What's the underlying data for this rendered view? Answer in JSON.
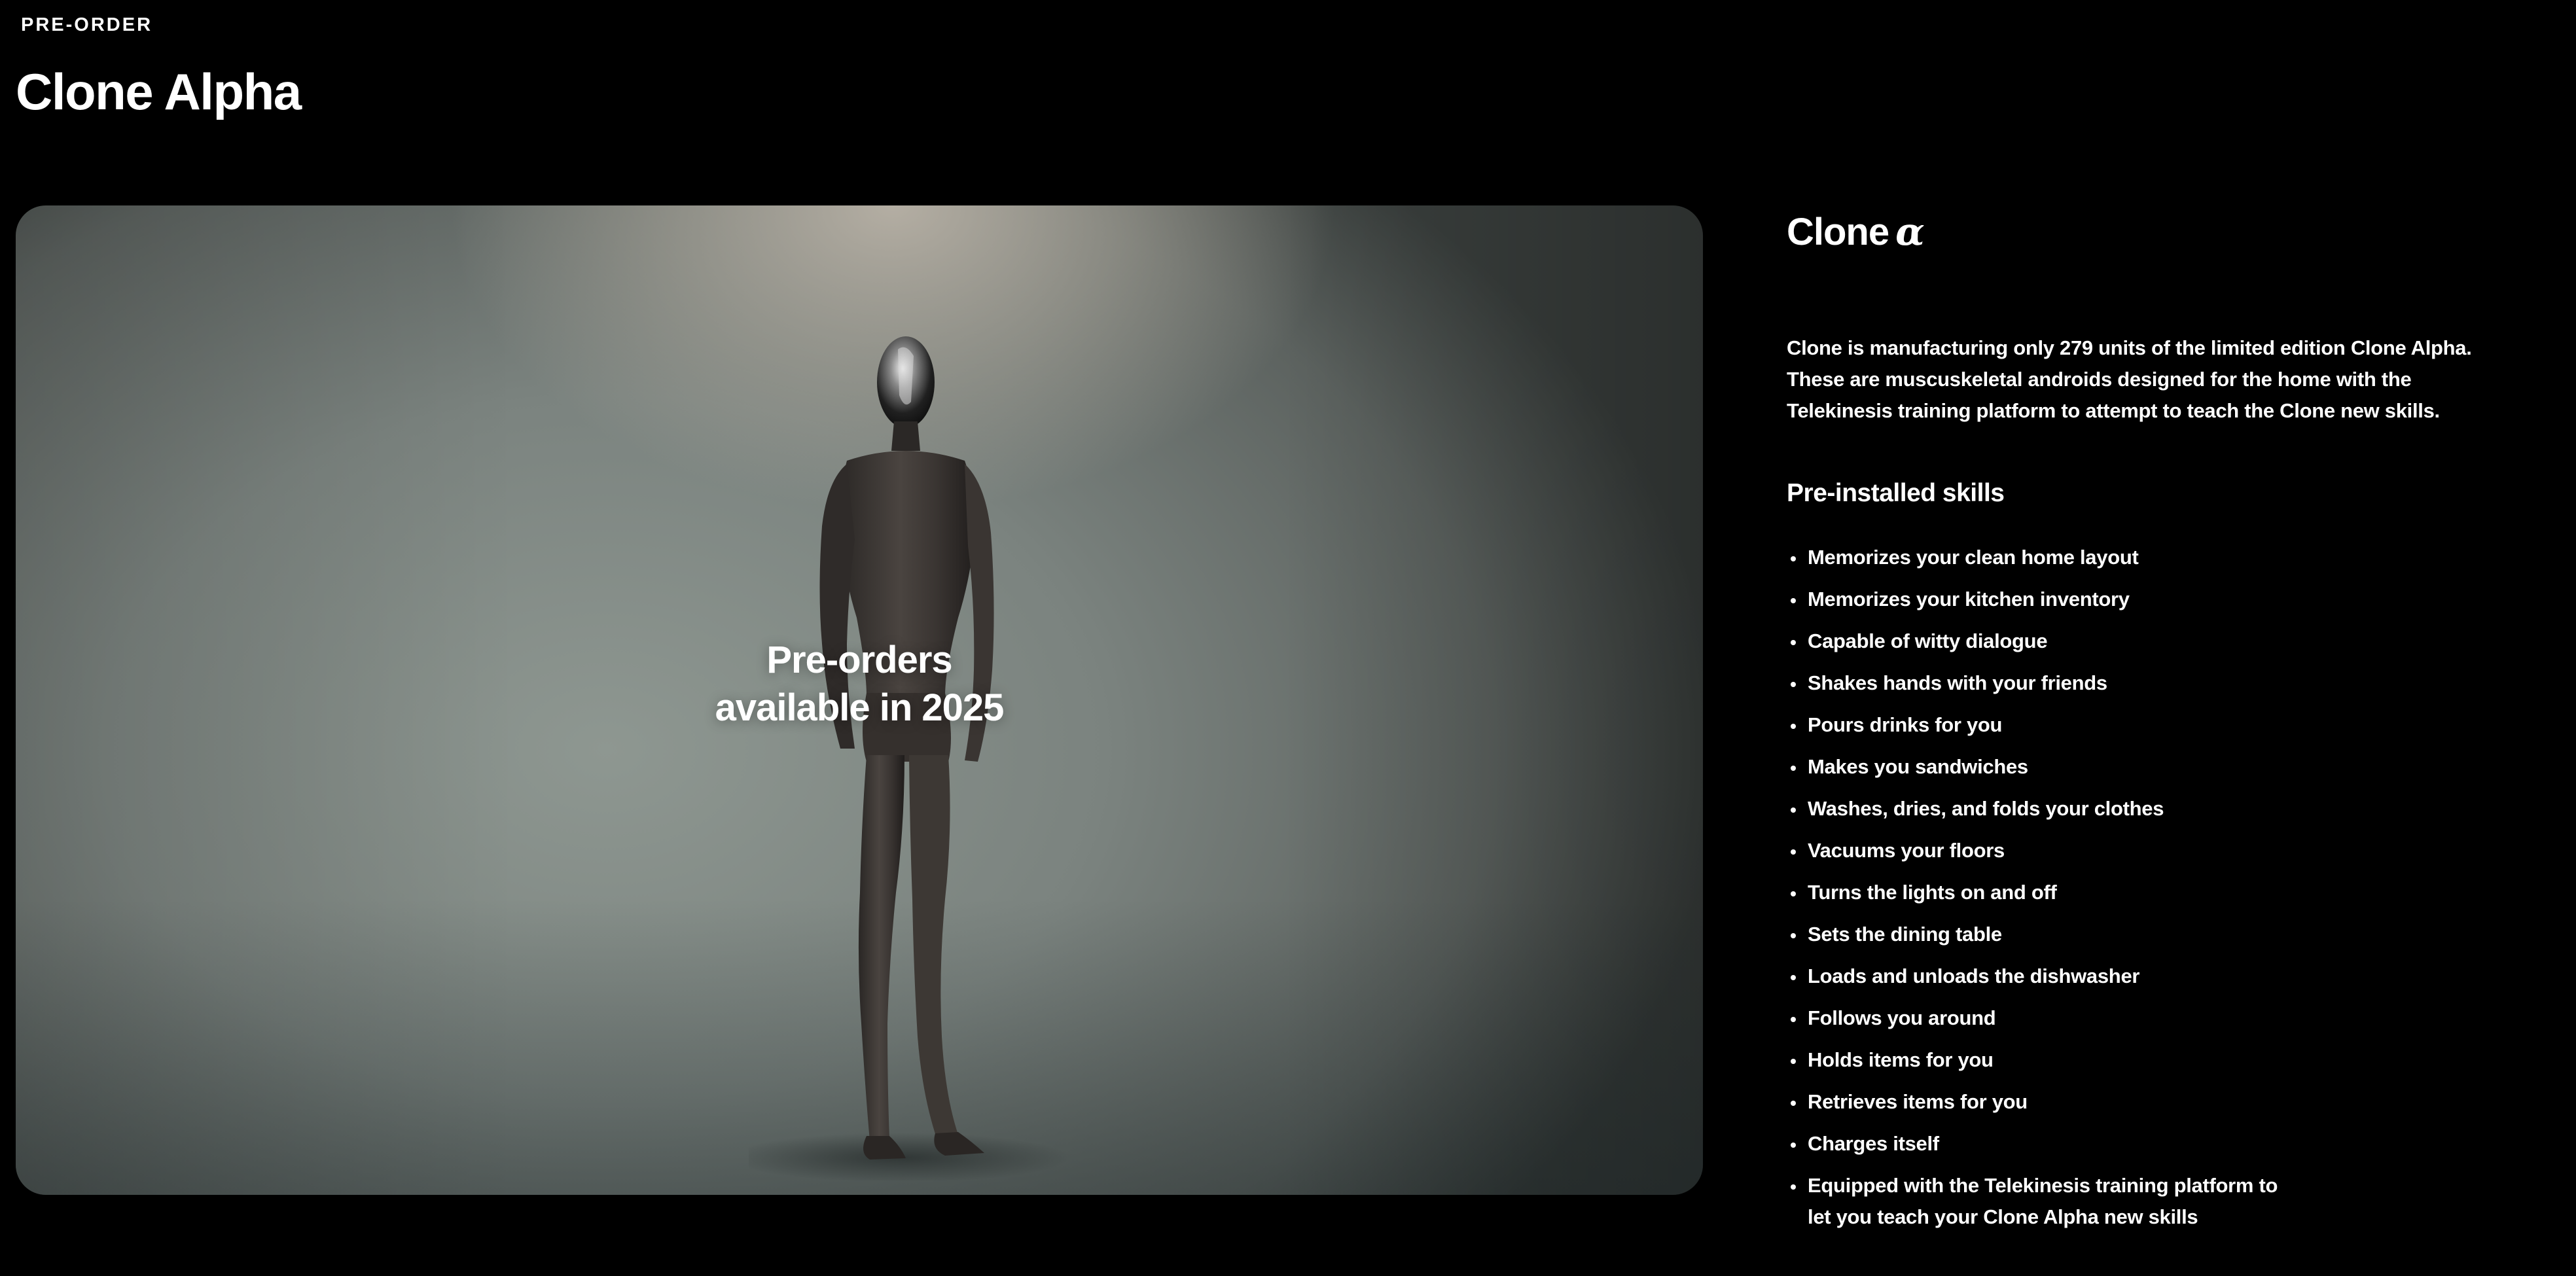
{
  "header": {
    "eyebrow": "PRE-ORDER",
    "title": "Clone Alpha"
  },
  "hero": {
    "overlay_line1": "Pre-orders",
    "overlay_line2": "available in 2025"
  },
  "panel": {
    "brand_name": "Clone",
    "brand_glyph": "α",
    "description": "Clone is manufacturing only 279 units of the limited edition Clone Alpha. These are muscuskeletal androids designed for the home with the Telekinesis training platform to attempt to teach the Clone new skills.",
    "skills_heading": "Pre-installed skills",
    "skills": [
      "Memorizes your clean home layout",
      "Memorizes your kitchen inventory",
      "Capable of witty dialogue",
      "Shakes hands with your friends",
      "Pours drinks for you",
      "Makes you sandwiches",
      "Washes, dries, and folds your clothes",
      "Vacuums your floors",
      "Turns the lights on and off",
      "Sets the dining table",
      "Loads and unloads the dishwasher",
      "Follows you around",
      "Holds items for you",
      "Retrieves items for you",
      "Charges itself",
      "Equipped with the Telekinesis training platform to let you teach your Clone Alpha new skills"
    ]
  },
  "colors": {
    "background": "#000000",
    "text": "#ffffff"
  }
}
